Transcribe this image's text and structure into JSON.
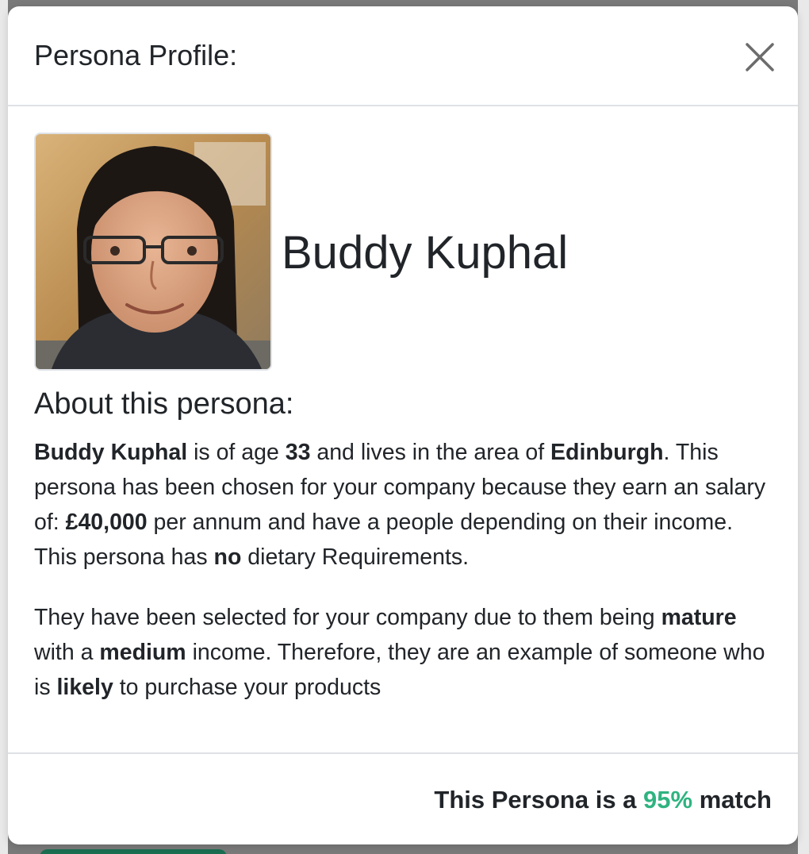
{
  "modal": {
    "title": "Persona Profile:",
    "close_icon": "close-icon"
  },
  "persona": {
    "name": "Buddy Kuphal",
    "age": "33",
    "area": "Edinburgh",
    "salary": "£40,000",
    "dietary": "no",
    "maturity": "mature",
    "income_level": "medium",
    "likelihood": "likely"
  },
  "about": {
    "heading": "About this persona:",
    "p1_t1": " is of age ",
    "p1_t2": " and lives in the area of ",
    "p1_t3": ". This persona has been chosen for your company because they earn an salary of: ",
    "p1_t4": " per annum and have a people depending on their income. This persona has ",
    "p1_t5": " dietary Requirements.",
    "p2_t1": "They have been selected for your company due to them being ",
    "p2_t2": " with a ",
    "p2_t3": " income. Therefore, they are an example of someone who is ",
    "p2_t4": " to purchase your products"
  },
  "footer": {
    "prefix": "This Persona is a ",
    "match_percent": "95%",
    "suffix": " match"
  },
  "colors": {
    "match_accent": "#2fb380",
    "text": "#212529",
    "divider": "#dee2e6"
  }
}
